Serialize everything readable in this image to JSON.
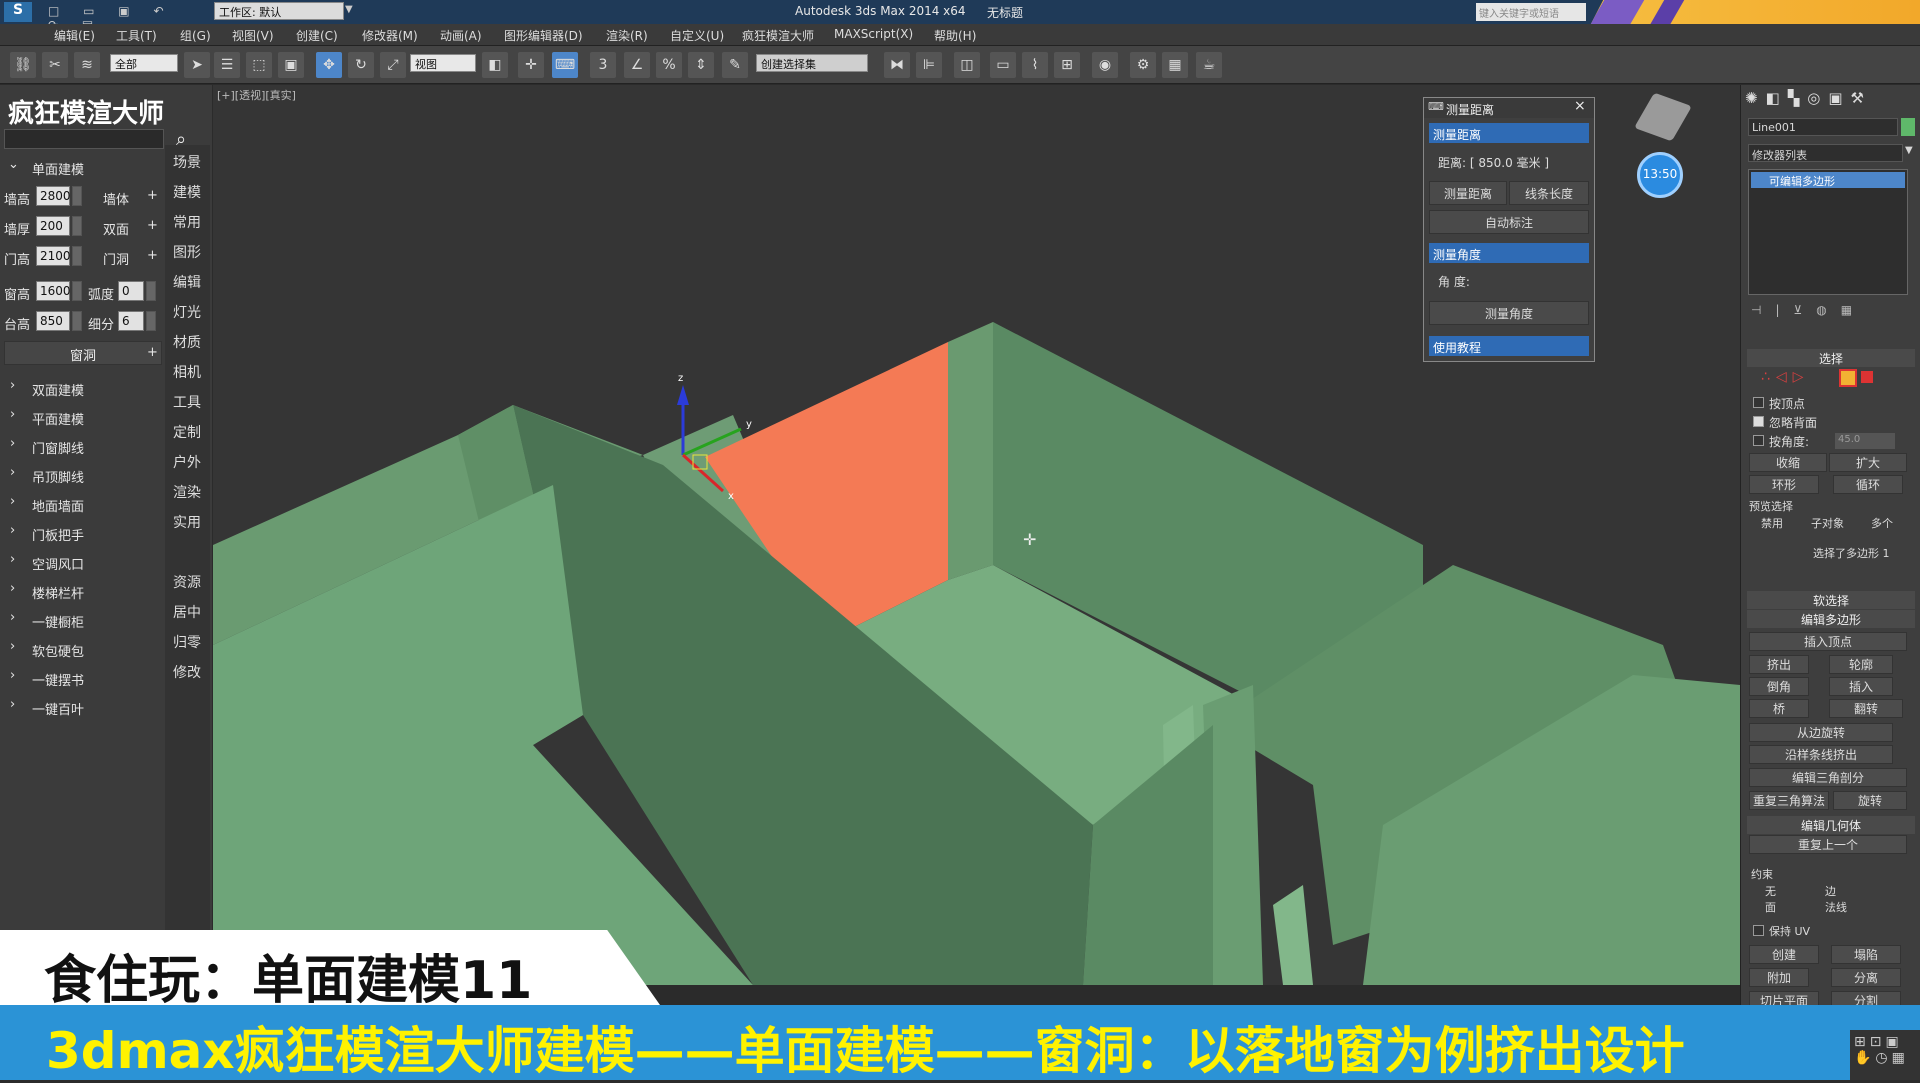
{
  "title_bar": {
    "workspace": "工作区: 默认",
    "app_title": "Autodesk 3ds Max  2014 x64",
    "file_title": "无标题",
    "search_placeholder": "键入关键字或短语"
  },
  "menu": [
    "编辑(E)",
    "工具(T)",
    "组(G)",
    "视图(V)",
    "创建(C)",
    "修改器(M)",
    "动画(A)",
    "图形编辑器(D)",
    "渲染(R)",
    "自定义(U)",
    "疯狂模渲大师",
    "MAXScript(X)",
    "帮助(H)"
  ],
  "toolbar": {
    "filter_value": "全部",
    "view_value": "视图",
    "selection_set_value": "创建选择集",
    "snap_labels": [
      "3",
      "",
      "%",
      ""
    ]
  },
  "left_panel": {
    "title": "疯狂模渲大师",
    "section_open": "单面建模",
    "fields": [
      {
        "label": "墙高",
        "value": "2800",
        "btn": "墙体"
      },
      {
        "label": "墙厚",
        "value": "200",
        "btn": "双面"
      },
      {
        "label": "门高",
        "value": "2100",
        "btn": "门洞"
      }
    ],
    "window_row": {
      "label": "窗高",
      "value": "1600",
      "label2": "弧度",
      "value2": "0"
    },
    "sill_row": {
      "label": "台高",
      "value": "850",
      "label2": "细分",
      "value2": "6"
    },
    "window_btn": "窗洞",
    "plus": "+",
    "sections": [
      "双面建模",
      "平面建模",
      "门窗脚线",
      "吊顶脚线",
      "地面墙面",
      "门板把手",
      "空调风口",
      "楼梯栏杆",
      "一键橱柜",
      "软包硬包",
      "一键摆书",
      "一键百叶"
    ],
    "categories": [
      "场景",
      "建模",
      "常用",
      "图形",
      "编辑",
      "灯光",
      "材质",
      "相机",
      "工具",
      "定制",
      "户外",
      "渲染",
      "实用",
      "",
      "资源",
      "居中",
      "归零",
      "修改"
    ]
  },
  "viewport": {
    "label": "[+][透视][真实]",
    "time": "13:50",
    "gizmo_labels": {
      "z": "z",
      "y": "y",
      "x": "x"
    }
  },
  "measure_dialog": {
    "title": "测量距离",
    "close": "×",
    "section_distance": "测量距离",
    "distance_text": "距离: [ 850.0 毫米 ]",
    "btn_measure": "测量距离",
    "btn_line_length": "线条长度",
    "btn_auto_dim": "自动标注",
    "section_angle": "测量角度",
    "angle_text": "角 度:",
    "btn_measure_angle": "测量角度",
    "section_tutorial": "使用教程"
  },
  "right_panel": {
    "object_name": "Line001",
    "modifier_list": "修改器列表",
    "stack_item": "可编辑多边形",
    "select_head": "选择",
    "by_vertex": "按顶点",
    "ignore_backface": "忽略背面",
    "by_angle": "按角度:",
    "angle_value": "45.0",
    "shrink": "收缩",
    "grow": "扩大",
    "ring": "环形",
    "loop": "循环",
    "preview_select": "预览选择",
    "preview_options": [
      "禁用",
      "子对象",
      "多个"
    ],
    "selected_info": "选择了多边形 1",
    "soft_select": "软选择",
    "edit_poly": "编辑多边形",
    "insert_vertex": "插入顶点",
    "extrude": "挤出",
    "outline": "轮廓",
    "bevel": "倒角",
    "inset": "插入",
    "bridge": "桥",
    "flip": "翻转",
    "hinge": "从边旋转",
    "extrude_spline": "沿样条线挤出",
    "edit_tri": "编辑三角剖分",
    "retriangulate": "重复三角算法",
    "turn": "旋转",
    "edit_geometry": "编辑几何体",
    "repeat_last": "重复上一个",
    "constraints": "约束",
    "constraint_options": [
      "无",
      "边",
      "面",
      "法线"
    ],
    "preserve_uv": "保持 UV",
    "create": "创建",
    "collapse": "塌陷",
    "attach": "附加",
    "detach": "分离",
    "slice_plane": "切片平面",
    "split": "分割"
  },
  "watermark": "食住玩",
  "caption_top": "食住玩：单面建模11",
  "caption_bottom": "3dmax疯狂模渲大师建模——单面建模——窗洞：以落地窗为例挤出设计",
  "colors": {
    "selected_face": "#f47a55",
    "wall": "#5e9068",
    "floor": "#6fa57a",
    "caption_blue": "#2b93d6",
    "accent": "#f2b233"
  }
}
